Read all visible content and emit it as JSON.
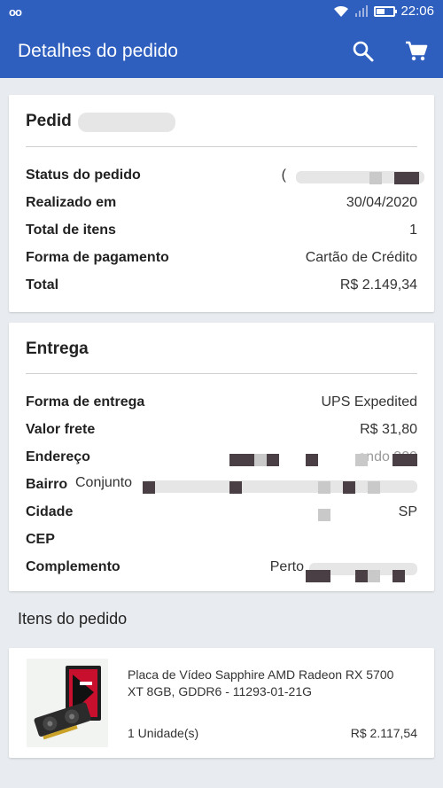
{
  "status_bar": {
    "time": "22:06"
  },
  "app_bar": {
    "title": "Detalhes do pedido"
  },
  "order_card": {
    "title": "Pedid",
    "rows": [
      {
        "label": "Status do pedido",
        "value": "("
      },
      {
        "label": "Realizado em",
        "value": "30/04/2020"
      },
      {
        "label": "Total de itens",
        "value": "1"
      },
      {
        "label": "Forma de pagamento",
        "value": "Cartão de Crédito"
      },
      {
        "label": "Total",
        "value": "R$ 2.149,34"
      }
    ]
  },
  "delivery_card": {
    "title": "Entrega",
    "rows": [
      {
        "label": "Forma de entrega",
        "value": "UPS Expedited"
      },
      {
        "label": "Valor frete",
        "value": "R$ 31,80"
      },
      {
        "label": "Endereço",
        "value": "ondo 309"
      },
      {
        "label": "Bairro",
        "value": "Conjunto"
      },
      {
        "label": "Cidade",
        "value": "SP"
      },
      {
        "label": "CEP",
        "value": ""
      },
      {
        "label": "Complemento",
        "value": "Perto"
      }
    ]
  },
  "items_section": {
    "title": "Itens do pedido",
    "items": [
      {
        "name": "Placa de Vídeo Sapphire AMD Radeon RX 5700 XT 8GB, GDDR6 - 11293-01-21G",
        "quantity": "1 Unidade(s)",
        "price": "R$ 2.117,54"
      }
    ]
  },
  "colors": {
    "primary": "#2e5fbf",
    "background": "#e8ebef",
    "card": "#ffffff"
  },
  "icons": [
    "voicemail-icon",
    "wifi-icon",
    "signal-icon",
    "battery-icon",
    "search-icon",
    "cart-icon"
  ]
}
